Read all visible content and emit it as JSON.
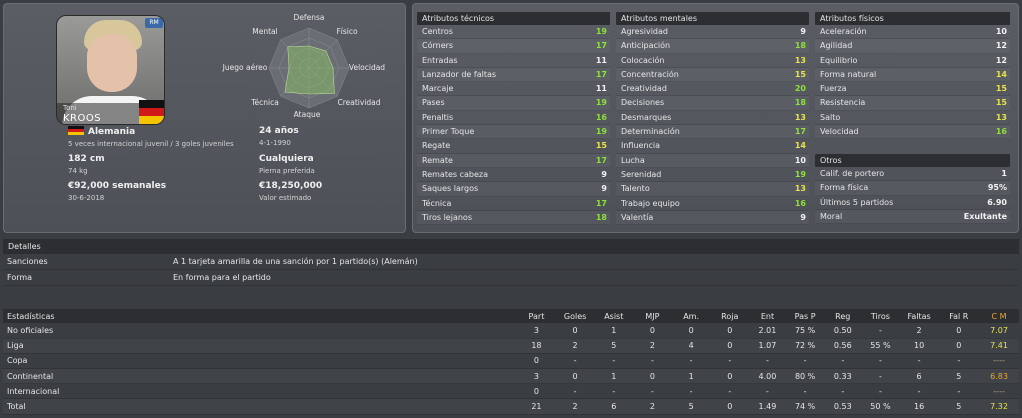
{
  "colors": {
    "high": "#8ee03a",
    "mid": "#e8e34a",
    "panel": "#545860",
    "header": "#2c2e32"
  },
  "player": {
    "first_name": "Toni",
    "last_name": "KROOS",
    "nationality": "Alemania",
    "intl_caps": "5 veces internacional juvenil / 3 goles juveniles",
    "age": "24 años",
    "dob": "4-1-1990",
    "height": "182 cm",
    "weight": "74 kg",
    "foot": "Cualquiera",
    "foot_label": "Pierna preferida",
    "wage": "€92,000 semanales",
    "contract_end": "30-6-2018",
    "value": "€18,250,000",
    "value_label": "Valor estimado"
  },
  "radar": {
    "labels": [
      "Defensa",
      "Físico",
      "Velocidad",
      "Creatividad",
      "Ataque",
      "Técnica",
      "Juego aéreo",
      "Mental"
    ],
    "levels": [
      0.55,
      0.6,
      0.6,
      0.9,
      0.65,
      0.85,
      0.5,
      0.75
    ]
  },
  "technical": {
    "header": "Atributos técnicos",
    "items": [
      {
        "name": "Centros",
        "value": "19"
      },
      {
        "name": "Córners",
        "value": "17"
      },
      {
        "name": "Entradas",
        "value": "11"
      },
      {
        "name": "Lanzador de faltas",
        "value": "17"
      },
      {
        "name": "Marcaje",
        "value": "11"
      },
      {
        "name": "Pases",
        "value": "19"
      },
      {
        "name": "Penaltis",
        "value": "16"
      },
      {
        "name": "Primer Toque",
        "value": "19"
      },
      {
        "name": "Regate",
        "value": "15"
      },
      {
        "name": "Remate",
        "value": "17"
      },
      {
        "name": "Remates cabeza",
        "value": "9"
      },
      {
        "name": "Saques largos",
        "value": "9"
      },
      {
        "name": "Técnica",
        "value": "17"
      },
      {
        "name": "Tiros lejanos",
        "value": "18"
      }
    ]
  },
  "mental": {
    "header": "Atributos mentales",
    "items": [
      {
        "name": "Agresividad",
        "value": "9"
      },
      {
        "name": "Anticipación",
        "value": "18"
      },
      {
        "name": "Colocación",
        "value": "13"
      },
      {
        "name": "Concentración",
        "value": "15"
      },
      {
        "name": "Creatividad",
        "value": "20"
      },
      {
        "name": "Decisiones",
        "value": "18"
      },
      {
        "name": "Desmarques",
        "value": "13"
      },
      {
        "name": "Determinación",
        "value": "17"
      },
      {
        "name": "Influencia",
        "value": "14"
      },
      {
        "name": "Lucha",
        "value": "10"
      },
      {
        "name": "Serenidad",
        "value": "19"
      },
      {
        "name": "Talento",
        "value": "13"
      },
      {
        "name": "Trabajo equipo",
        "value": "16"
      },
      {
        "name": "Valentía",
        "value": "9"
      }
    ]
  },
  "physical": {
    "header": "Atributos físicos",
    "items": [
      {
        "name": "Aceleración",
        "value": "10"
      },
      {
        "name": "Agilidad",
        "value": "12"
      },
      {
        "name": "Equilibrio",
        "value": "12"
      },
      {
        "name": "Forma natural",
        "value": "14"
      },
      {
        "name": "Fuerza",
        "value": "15"
      },
      {
        "name": "Resistencia",
        "value": "15"
      },
      {
        "name": "Salto",
        "value": "13"
      },
      {
        "name": "Velocidad",
        "value": "16"
      }
    ]
  },
  "others": {
    "header": "Otros",
    "items": [
      {
        "name": "Calif. de portero",
        "value": "1"
      },
      {
        "name": "Forma física",
        "value": "95%"
      },
      {
        "name": "Últimos 5 partidos",
        "value": "6.90"
      },
      {
        "name": "Moral",
        "value": "Exultante"
      }
    ]
  },
  "details": {
    "header": "Detalles",
    "rows": [
      {
        "key": "Sanciones",
        "value": "A 1 tarjeta amarilla de una sanción por 1 partido(s) (Alemán)"
      },
      {
        "key": "Forma",
        "value": "En forma para el partido"
      }
    ]
  },
  "stats": {
    "header": "Estadísticas",
    "columns": [
      "Part",
      "Goles",
      "Asist",
      "MJP",
      "Am.",
      "Roja",
      "Ent",
      "Pas P",
      "Reg",
      "Tiros",
      "Faltas",
      "Fal R",
      "C M"
    ],
    "rows": [
      {
        "label": "No oficiales",
        "cells": [
          "3",
          "0",
          "1",
          "0",
          "0",
          "0",
          "2.01",
          "75 %",
          "0.50",
          "-",
          "2",
          "0",
          "7.07"
        ]
      },
      {
        "label": "Liga",
        "cells": [
          "18",
          "2",
          "5",
          "2",
          "4",
          "0",
          "1.07",
          "72 %",
          "0.56",
          "55 %",
          "10",
          "0",
          "7.41"
        ]
      },
      {
        "label": "Copa",
        "cells": [
          "0",
          "-",
          "-",
          "-",
          "-",
          "-",
          "-",
          "-",
          "-",
          "-",
          "-",
          "-",
          "----"
        ]
      },
      {
        "label": "Continental",
        "cells": [
          "3",
          "0",
          "1",
          "0",
          "1",
          "0",
          "4.00",
          "80 %",
          "0.33",
          "-",
          "6",
          "5",
          "6.83"
        ]
      },
      {
        "label": "Internacional",
        "cells": [
          "0",
          "-",
          "-",
          "-",
          "-",
          "-",
          "-",
          "-",
          "-",
          "-",
          "-",
          "-",
          "----"
        ]
      },
      {
        "label": "Total",
        "cells": [
          "21",
          "2",
          "6",
          "2",
          "5",
          "0",
          "1.49",
          "74 %",
          "0.53",
          "50 %",
          "16",
          "5",
          "7.32"
        ]
      }
    ]
  }
}
